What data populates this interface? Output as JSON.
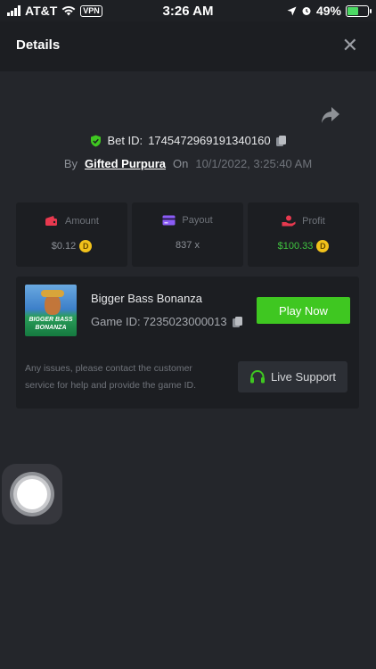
{
  "status_bar": {
    "carrier": "AT&T",
    "vpn": "VPN",
    "time": "3:26 AM",
    "battery": "49%"
  },
  "header": {
    "title": "Details",
    "close": "✕"
  },
  "bet": {
    "id_label": "Bet ID:",
    "id_value": "174547296919134016​0",
    "by_label": "By",
    "user": "Gifted Purpura",
    "on_label": "On",
    "datetime": "10/1/2022, 3:25:40 AM"
  },
  "stats": {
    "amount": {
      "label": "Amount",
      "value": "$0.12",
      "coin": "D"
    },
    "payout": {
      "label": "Payout",
      "value": "837 x"
    },
    "profit": {
      "label": "Profit",
      "value": "$100.33",
      "coin": "D"
    }
  },
  "game": {
    "name": "Bigger Bass Bonanza",
    "id_label": "Game ID:",
    "id_value": "7235023000013",
    "thumb_line1": "BIGGER BASS",
    "thumb_line2": "BONANZA",
    "play_label": "Play Now"
  },
  "support": {
    "notice": "Any issues, please contact the customer service for help and provide the game ID.",
    "button_label": "Live Support"
  },
  "colors": {
    "accent_green": "#3fc721",
    "profit_green": "#40c740",
    "coin_gold": "#f2c21b",
    "background": "#24262b",
    "card": "#1c1e22"
  },
  "icons": {
    "shield": "shield-check-icon",
    "share": "share-arrow-icon",
    "copy": "copy-icon",
    "amount": "wallet-icon",
    "payout": "card-icon",
    "profit": "hand-coin-icon",
    "support": "headset-icon",
    "close": "close-icon"
  }
}
